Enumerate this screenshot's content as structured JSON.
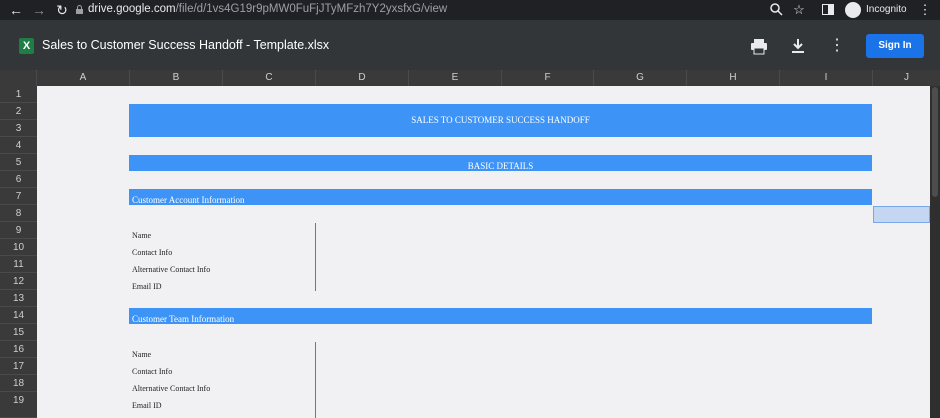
{
  "browser": {
    "url_host": "drive.google.com",
    "url_path": "/file/d/1vs4G19r9pMW0FuFjJTyMFzh7Y2yxsfxG/view",
    "incognito_label": "Incognito"
  },
  "viewer": {
    "file_icon_letter": "X",
    "file_title": "Sales to Customer Success Handoff - Template.xlsx",
    "signin_label": "Sign In"
  },
  "sheet": {
    "columns": [
      "A",
      "B",
      "C",
      "D",
      "E",
      "F",
      "G",
      "H",
      "I",
      "J"
    ],
    "rows": [
      "1",
      "2",
      "3",
      "4",
      "5",
      "6",
      "7",
      "8",
      "9",
      "10",
      "11",
      "12",
      "13",
      "14",
      "15",
      "16",
      "17",
      "18",
      "19"
    ],
    "title_banner": "SALES TO CUSTOMER SUCCESS HANDOFF",
    "section_banner": "BASIC DETAILS",
    "account_header": "Customer Account Information",
    "account_fields": [
      "Name",
      "Contact Info",
      "Alternative Contact Info",
      "Email ID"
    ],
    "team_header": "Customer Team Information",
    "team_fields": [
      "Name",
      "Contact Info",
      "Alternative Contact Info",
      "Email ID"
    ]
  },
  "colors": {
    "band": "#3d94f6",
    "signin": "#1a73e8"
  }
}
